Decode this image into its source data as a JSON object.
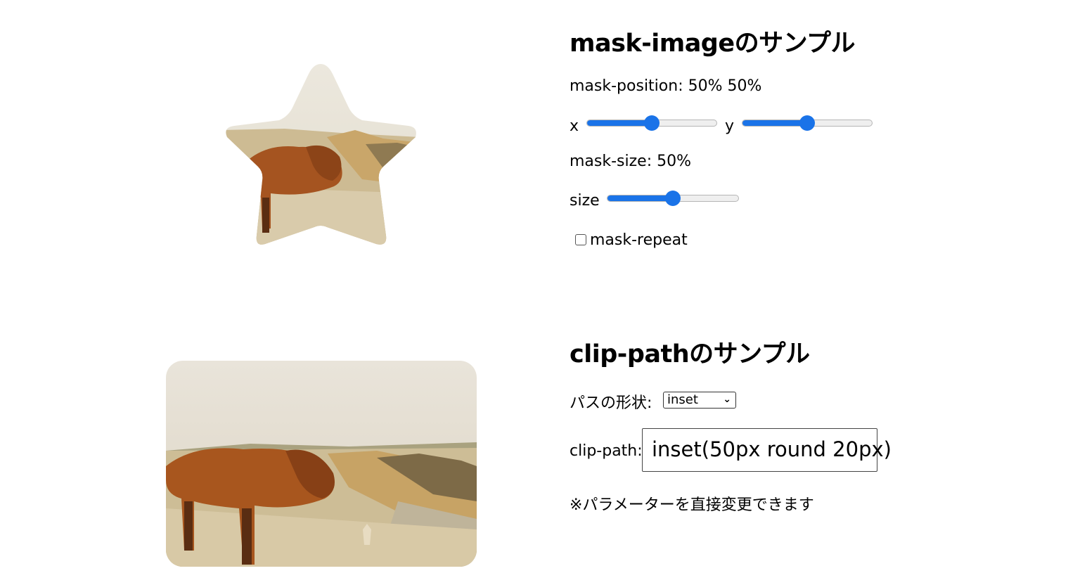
{
  "mask_section": {
    "title": "mask-imageのサンプル",
    "position_label": "mask-position: 50% 50%",
    "x_label": "x",
    "y_label": "y",
    "x_value": 50,
    "y_value": 50,
    "size_label_text": "mask-size: 50%",
    "size_slider_label": "size",
    "size_value": 50,
    "repeat_label": "mask-repeat",
    "repeat_checked": false
  },
  "clip_section": {
    "title": "clip-pathのサンプル",
    "shape_label": "パスの形状:",
    "shape_selected": "inset",
    "clip_label": "clip-path:",
    "clip_value": "inset(50px round 20px)",
    "note": "※パラメーターを直接変更できます"
  },
  "colors": {
    "accent": "#1a73e8",
    "sky": "#e8e2d4",
    "sand": "#d8c9a3",
    "cow": "#a8561e"
  }
}
